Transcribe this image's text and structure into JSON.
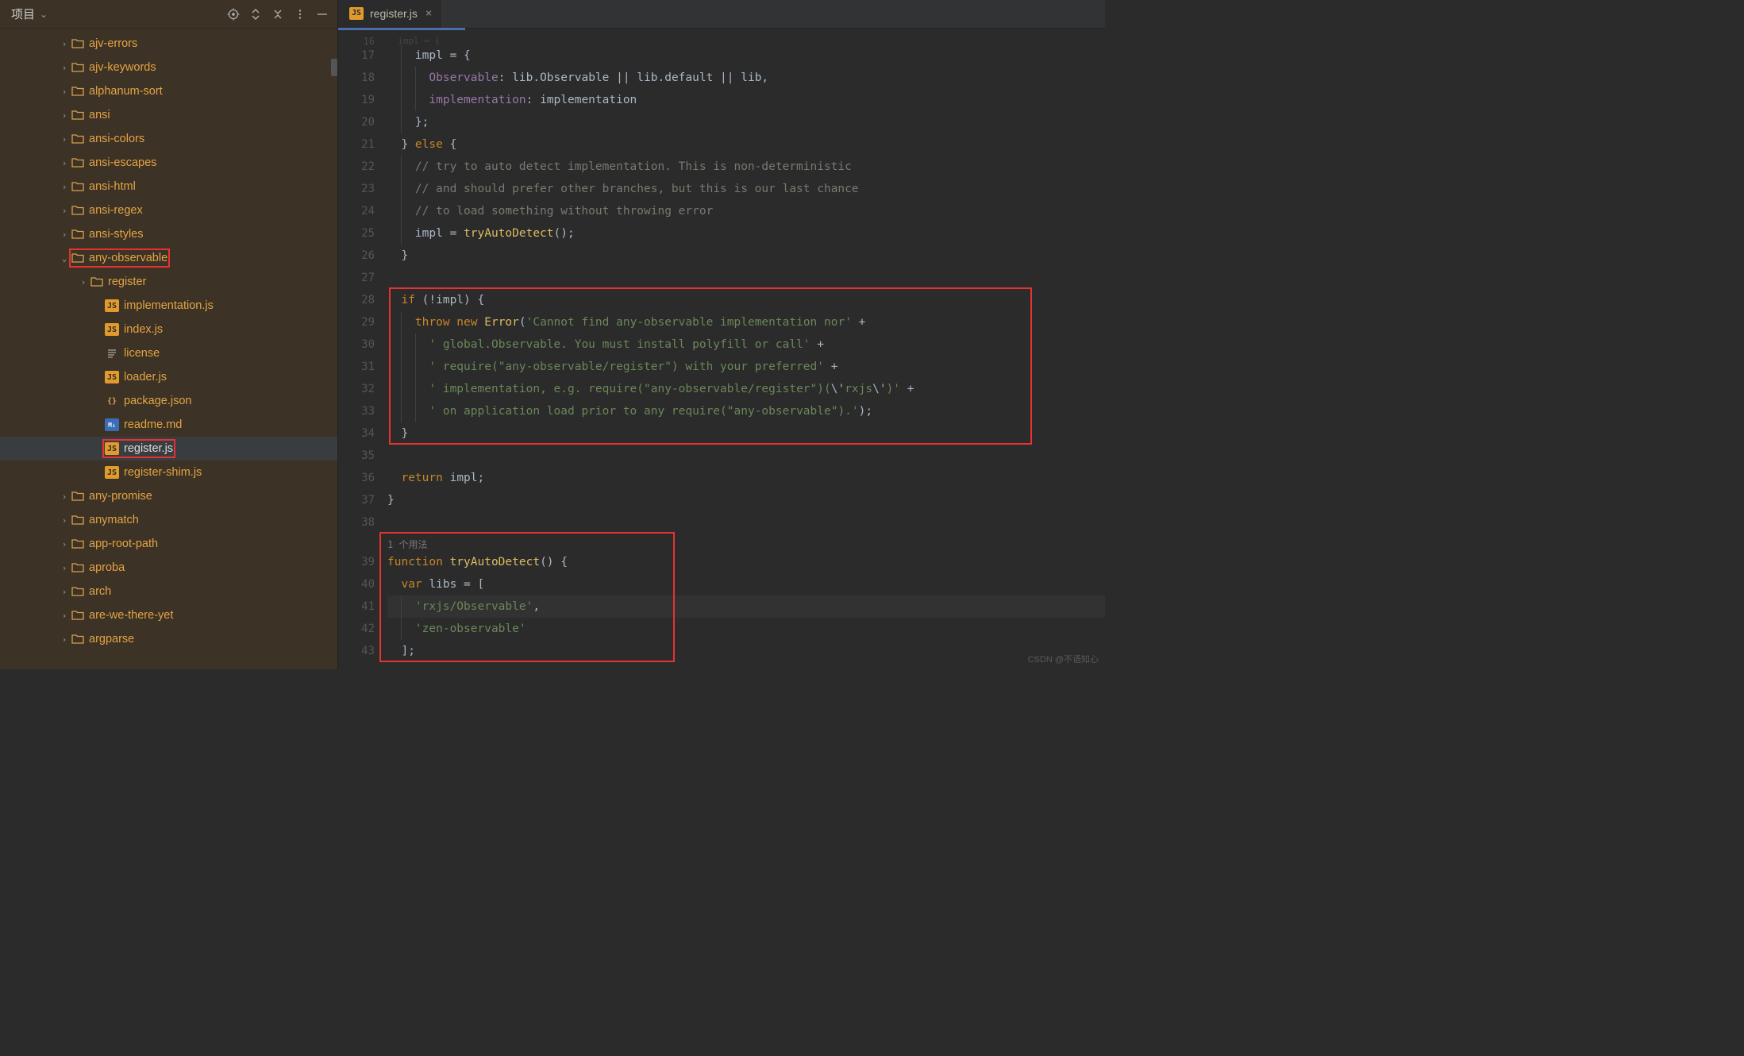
{
  "sidebar": {
    "title": "项目",
    "items": [
      {
        "type": "folder",
        "label": "ajv-errors",
        "expanded": false,
        "depth": 0
      },
      {
        "type": "folder",
        "label": "ajv-keywords",
        "expanded": false,
        "depth": 0
      },
      {
        "type": "folder",
        "label": "alphanum-sort",
        "expanded": false,
        "depth": 0
      },
      {
        "type": "folder",
        "label": "ansi",
        "expanded": false,
        "depth": 0
      },
      {
        "type": "folder",
        "label": "ansi-colors",
        "expanded": false,
        "depth": 0
      },
      {
        "type": "folder",
        "label": "ansi-escapes",
        "expanded": false,
        "depth": 0
      },
      {
        "type": "folder",
        "label": "ansi-html",
        "expanded": false,
        "depth": 0
      },
      {
        "type": "folder",
        "label": "ansi-regex",
        "expanded": false,
        "depth": 0
      },
      {
        "type": "folder",
        "label": "ansi-styles",
        "expanded": false,
        "depth": 0
      },
      {
        "type": "folder",
        "label": "any-observable",
        "expanded": true,
        "depth": 0,
        "highlight": true
      },
      {
        "type": "folder",
        "label": "register",
        "expanded": false,
        "depth": 1
      },
      {
        "type": "file",
        "icon": "js",
        "label": "implementation.js",
        "depth": 1
      },
      {
        "type": "file",
        "icon": "js",
        "label": "index.js",
        "depth": 1
      },
      {
        "type": "file",
        "icon": "license",
        "label": "license",
        "depth": 1
      },
      {
        "type": "file",
        "icon": "js",
        "label": "loader.js",
        "depth": 1
      },
      {
        "type": "file",
        "icon": "json",
        "label": "package.json",
        "depth": 1
      },
      {
        "type": "file",
        "icon": "md",
        "label": "readme.md",
        "depth": 1
      },
      {
        "type": "file",
        "icon": "js",
        "label": "register.js",
        "depth": 1,
        "selected": true,
        "highlight": true
      },
      {
        "type": "file",
        "icon": "js",
        "label": "register-shim.js",
        "depth": 1
      },
      {
        "type": "folder",
        "label": "any-promise",
        "expanded": false,
        "depth": 0
      },
      {
        "type": "folder",
        "label": "anymatch",
        "expanded": false,
        "depth": 0
      },
      {
        "type": "folder",
        "label": "app-root-path",
        "expanded": false,
        "depth": 0
      },
      {
        "type": "folder",
        "label": "aproba",
        "expanded": false,
        "depth": 0
      },
      {
        "type": "folder",
        "label": "arch",
        "expanded": false,
        "depth": 0
      },
      {
        "type": "folder",
        "label": "are-we-there-yet",
        "expanded": false,
        "depth": 0
      },
      {
        "type": "folder",
        "label": "argparse",
        "expanded": false,
        "depth": 0
      }
    ]
  },
  "tab": {
    "label": "register.js"
  },
  "usages_hint": "1 个用法",
  "code_lines": [
    {
      "n": 16,
      "html": "  impl = {",
      "small": true
    },
    {
      "n": 17,
      "html": "    impl = {"
    },
    {
      "n": 18,
      "html": "      <span class=\"prop\">Observable</span>: lib.Observable || lib.default || lib,"
    },
    {
      "n": 19,
      "html": "      <span class=\"prop\">implementation</span>: implementation"
    },
    {
      "n": 20,
      "html": "    };"
    },
    {
      "n": 21,
      "html": "  } <span class=\"kw\">else</span> {"
    },
    {
      "n": 22,
      "html": "    <span class=\"comment\">// try to auto detect implementation. This is non-deterministic</span>"
    },
    {
      "n": 23,
      "html": "    <span class=\"comment\">// and should prefer other branches, but this is our last chance</span>"
    },
    {
      "n": 24,
      "html": "    <span class=\"comment\">// to load something without throwing error</span>"
    },
    {
      "n": 25,
      "html": "    impl = <span class=\"fn\">tryAutoDetect</span>();"
    },
    {
      "n": 26,
      "html": "  }"
    },
    {
      "n": 27,
      "html": ""
    },
    {
      "n": 28,
      "html": "  <span class=\"kw\">if</span> (!impl) {"
    },
    {
      "n": 29,
      "html": "    <span class=\"kw\">throw new</span> <span class=\"fn\">Error</span>(<span class=\"str\">'Cannot find any-observable implementation nor'</span> +"
    },
    {
      "n": 30,
      "html": "      <span class=\"str\">' global.Observable. You must install polyfill or call'</span> +"
    },
    {
      "n": 31,
      "html": "      <span class=\"str\">' require(\"any-observable/register\") with your preferred'</span> +"
    },
    {
      "n": 32,
      "html": "      <span class=\"str\">' implementation, e.g. require(\"any-observable/register\")(</span>\\'<span class=\"str\">rxjs</span>\\'<span class=\"str\">)'</span> +"
    },
    {
      "n": 33,
      "html": "      <span class=\"str\">' on application load prior to any require(\"any-observable\").'</span>);"
    },
    {
      "n": 34,
      "html": "  }"
    },
    {
      "n": 35,
      "html": ""
    },
    {
      "n": 36,
      "html": "  <span class=\"kw\">return</span> impl;"
    },
    {
      "n": 37,
      "html": "}"
    },
    {
      "n": 38,
      "html": ""
    },
    {
      "n": 0,
      "html": "1 个用法",
      "small": true,
      "hint": true
    },
    {
      "n": 39,
      "html": "<span class=\"kw\">function</span> <span class=\"fn\">tryAutoDetect</span>() {"
    },
    {
      "n": 40,
      "html": "  <span class=\"kw\">var</span> libs = ["
    },
    {
      "n": 41,
      "html": "    <span class=\"str\">'rxjs/Observable'</span>,",
      "hl": true
    },
    {
      "n": 42,
      "html": "    <span class=\"str\">'zen-observable'</span>"
    },
    {
      "n": 43,
      "html": "  ];"
    }
  ],
  "watermark": "CSDN @不语知心"
}
